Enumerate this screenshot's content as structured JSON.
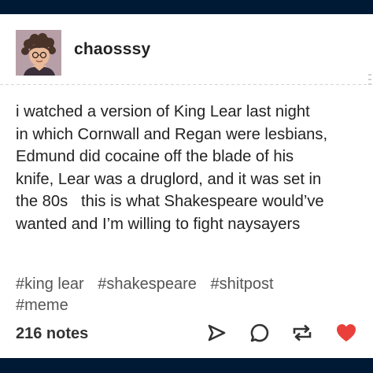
{
  "post": {
    "username": "chaosssy",
    "body_lines": [
      "i watched a version of King Lear last night",
      "in which Cornwall and Regan were lesbians,",
      "Edmund did cocaine off the blade of his",
      "knife, Lear was a druglord, and it was set in",
      "the 80s   this is what Shakespeare would’ve",
      "wanted and I’m willing to fight naysayers"
    ],
    "tags": [
      "#king lear",
      "#shakespeare",
      "#shitpost",
      "#meme"
    ],
    "notes": "216 notes"
  },
  "actions": {
    "share_icon": "share-icon",
    "reply_icon": "reply-icon",
    "reblog_icon": "reblog-icon",
    "like_icon": "heart-icon"
  },
  "colors": {
    "background_frame": "#001935",
    "card": "#ffffff",
    "text": "#222222",
    "tags": "#555555",
    "like": "#e9403b",
    "avatar_bg": "#b79fa8"
  }
}
